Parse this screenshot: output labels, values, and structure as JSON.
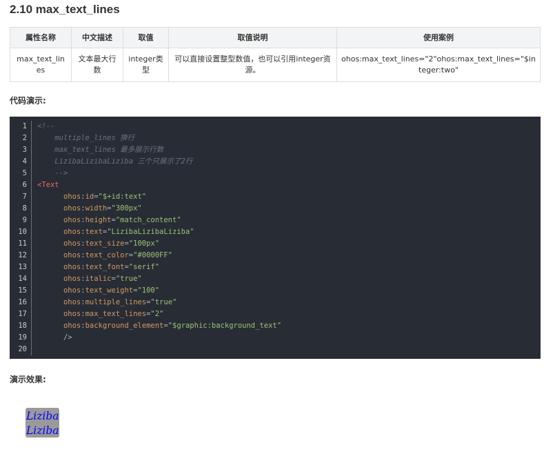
{
  "section": {
    "title": "2.10 max_text_lines"
  },
  "attribute_table": {
    "headers": [
      "属性名称",
      "中文描述",
      "取值",
      "取值说明",
      "使用案例"
    ],
    "rows": [
      [
        "max_text_lines",
        "文本最大行数",
        "integer类型",
        "可以直接设置整型数值，也可以引用integer资源。",
        "ohos:max_text_lines=\"2\"ohos:max_text_lines=\"$integer:two\""
      ]
    ]
  },
  "code_label": "代码演示:",
  "code_lines": [
    {
      "n": "1",
      "tokens": [
        {
          "t": "comment",
          "v": "<!--"
        }
      ]
    },
    {
      "n": "2",
      "tokens": [
        {
          "t": "comment",
          "v": "    multiple_lines 换行"
        }
      ]
    },
    {
      "n": "3",
      "tokens": [
        {
          "t": "comment",
          "v": "    max_text_lines 最多展示行数"
        }
      ]
    },
    {
      "n": "4",
      "tokens": [
        {
          "t": "comment",
          "v": "    LizibaLizibaLiziba 三个只展示了2行"
        }
      ]
    },
    {
      "n": "5",
      "tokens": [
        {
          "t": "comment",
          "v": "    -->"
        }
      ]
    },
    {
      "n": "6",
      "tokens": [
        {
          "t": "tag",
          "v": "<Text"
        }
      ]
    },
    {
      "n": "7",
      "tokens": [
        {
          "t": "plain",
          "v": "      "
        },
        {
          "t": "ns",
          "v": "ohos"
        },
        {
          "t": "punc",
          "v": ":"
        },
        {
          "t": "attr",
          "v": "id"
        },
        {
          "t": "punc",
          "v": "="
        },
        {
          "t": "str",
          "v": "\"$+id:text\""
        }
      ]
    },
    {
      "n": "8",
      "tokens": [
        {
          "t": "plain",
          "v": "      "
        },
        {
          "t": "ns",
          "v": "ohos"
        },
        {
          "t": "punc",
          "v": ":"
        },
        {
          "t": "attr",
          "v": "width"
        },
        {
          "t": "punc",
          "v": "="
        },
        {
          "t": "str",
          "v": "\"300px\""
        }
      ]
    },
    {
      "n": "9",
      "tokens": [
        {
          "t": "plain",
          "v": "      "
        },
        {
          "t": "ns",
          "v": "ohos"
        },
        {
          "t": "punc",
          "v": ":"
        },
        {
          "t": "attr",
          "v": "height"
        },
        {
          "t": "punc",
          "v": "="
        },
        {
          "t": "str",
          "v": "\"match_content\""
        }
      ]
    },
    {
      "n": "10",
      "tokens": [
        {
          "t": "plain",
          "v": "      "
        },
        {
          "t": "ns",
          "v": "ohos"
        },
        {
          "t": "punc",
          "v": ":"
        },
        {
          "t": "attr",
          "v": "text"
        },
        {
          "t": "punc",
          "v": "="
        },
        {
          "t": "str",
          "v": "\"LizibaLizibaLiziba\""
        }
      ]
    },
    {
      "n": "11",
      "tokens": [
        {
          "t": "plain",
          "v": "      "
        },
        {
          "t": "ns",
          "v": "ohos"
        },
        {
          "t": "punc",
          "v": ":"
        },
        {
          "t": "attr",
          "v": "text_size"
        },
        {
          "t": "punc",
          "v": "="
        },
        {
          "t": "str",
          "v": "\"100px\""
        }
      ]
    },
    {
      "n": "12",
      "tokens": [
        {
          "t": "plain",
          "v": "      "
        },
        {
          "t": "ns",
          "v": "ohos"
        },
        {
          "t": "punc",
          "v": ":"
        },
        {
          "t": "attr",
          "v": "text_color"
        },
        {
          "t": "punc",
          "v": "="
        },
        {
          "t": "str",
          "v": "\"#0000FF\""
        }
      ]
    },
    {
      "n": "13",
      "tokens": [
        {
          "t": "plain",
          "v": "      "
        },
        {
          "t": "ns",
          "v": "ohos"
        },
        {
          "t": "punc",
          "v": ":"
        },
        {
          "t": "attr",
          "v": "text_font"
        },
        {
          "t": "punc",
          "v": "="
        },
        {
          "t": "str",
          "v": "\"serif\""
        }
      ]
    },
    {
      "n": "14",
      "tokens": [
        {
          "t": "plain",
          "v": "      "
        },
        {
          "t": "ns",
          "v": "ohos"
        },
        {
          "t": "punc",
          "v": ":"
        },
        {
          "t": "attr",
          "v": "italic"
        },
        {
          "t": "punc",
          "v": "="
        },
        {
          "t": "str",
          "v": "\"true\""
        }
      ]
    },
    {
      "n": "15",
      "tokens": [
        {
          "t": "plain",
          "v": "      "
        },
        {
          "t": "ns",
          "v": "ohos"
        },
        {
          "t": "punc",
          "v": ":"
        },
        {
          "t": "attr",
          "v": "text_weight"
        },
        {
          "t": "punc",
          "v": "="
        },
        {
          "t": "str",
          "v": "\"100\""
        }
      ]
    },
    {
      "n": "16",
      "tokens": [
        {
          "t": "plain",
          "v": "      "
        },
        {
          "t": "ns",
          "v": "ohos"
        },
        {
          "t": "punc",
          "v": ":"
        },
        {
          "t": "attr",
          "v": "multiple_lines"
        },
        {
          "t": "punc",
          "v": "="
        },
        {
          "t": "str",
          "v": "\"true\""
        }
      ]
    },
    {
      "n": "17",
      "tokens": [
        {
          "t": "plain",
          "v": "      "
        },
        {
          "t": "ns",
          "v": "ohos"
        },
        {
          "t": "punc",
          "v": ":"
        },
        {
          "t": "attr",
          "v": "max_text_lines"
        },
        {
          "t": "punc",
          "v": "="
        },
        {
          "t": "str",
          "v": "\"2\""
        }
      ]
    },
    {
      "n": "18",
      "tokens": [
        {
          "t": "plain",
          "v": "      "
        },
        {
          "t": "ns",
          "v": "ohos"
        },
        {
          "t": "punc",
          "v": ":"
        },
        {
          "t": "attr",
          "v": "background_element"
        },
        {
          "t": "punc",
          "v": "="
        },
        {
          "t": "str",
          "v": "\"$graphic:background_text\""
        }
      ]
    },
    {
      "n": "19",
      "tokens": [
        {
          "t": "plain",
          "v": "      "
        },
        {
          "t": "punc",
          "v": "/>"
        }
      ]
    },
    {
      "n": "20",
      "tokens": []
    }
  ],
  "demo_label": "演示效果:",
  "demo": {
    "lines": [
      "Liziba",
      "Liziba"
    ]
  },
  "colors": {
    "code_background": "#282c34",
    "table_header_background": "#f3f4f5",
    "demo_background": "#9a9a9a",
    "demo_text": "#0000ff"
  }
}
